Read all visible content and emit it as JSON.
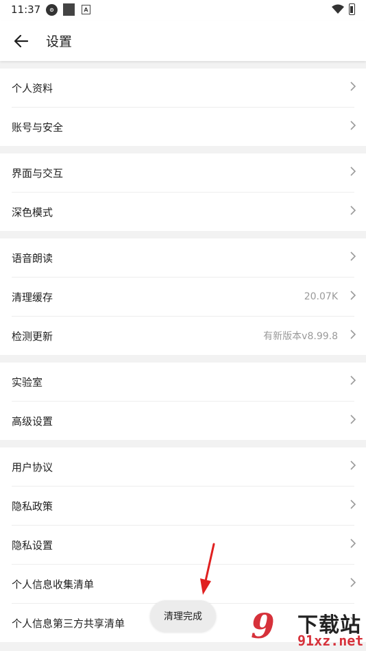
{
  "status_bar": {
    "time": "11:37",
    "icons": [
      "notification-icon",
      "square-icon",
      "a-icon",
      "wifi-icon",
      "battery-icon"
    ]
  },
  "header": {
    "title": "设置",
    "back_icon": "arrow-left-icon"
  },
  "groups": [
    {
      "items": [
        {
          "label": "个人资料",
          "value": ""
        },
        {
          "label": "账号与安全",
          "value": ""
        }
      ]
    },
    {
      "items": [
        {
          "label": "界面与交互",
          "value": ""
        },
        {
          "label": "深色模式",
          "value": ""
        }
      ]
    },
    {
      "items": [
        {
          "label": "语音朗读",
          "value": ""
        },
        {
          "label": "清理缓存",
          "value": "20.07K"
        },
        {
          "label": "检测更新",
          "value": "有新版本v8.99.8"
        }
      ]
    },
    {
      "items": [
        {
          "label": "实验室",
          "value": ""
        },
        {
          "label": "高级设置",
          "value": ""
        }
      ]
    },
    {
      "items": [
        {
          "label": "用户协议",
          "value": ""
        },
        {
          "label": "隐私政策",
          "value": ""
        },
        {
          "label": "隐私设置",
          "value": ""
        },
        {
          "label": "个人信息收集清单",
          "value": ""
        },
        {
          "label": "个人信息第三方共享清单",
          "value": ""
        }
      ]
    }
  ],
  "toast": {
    "text": "清理完成"
  },
  "watermark": {
    "logo": "9",
    "top_text": "下载站",
    "bottom_text": "91xz.net"
  },
  "colors": {
    "background": "#f2f2f2",
    "surface": "#ffffff",
    "secondary_text": "#9a9a9a",
    "annotation_red": "#e02020",
    "watermark_red": "#d6313a"
  }
}
